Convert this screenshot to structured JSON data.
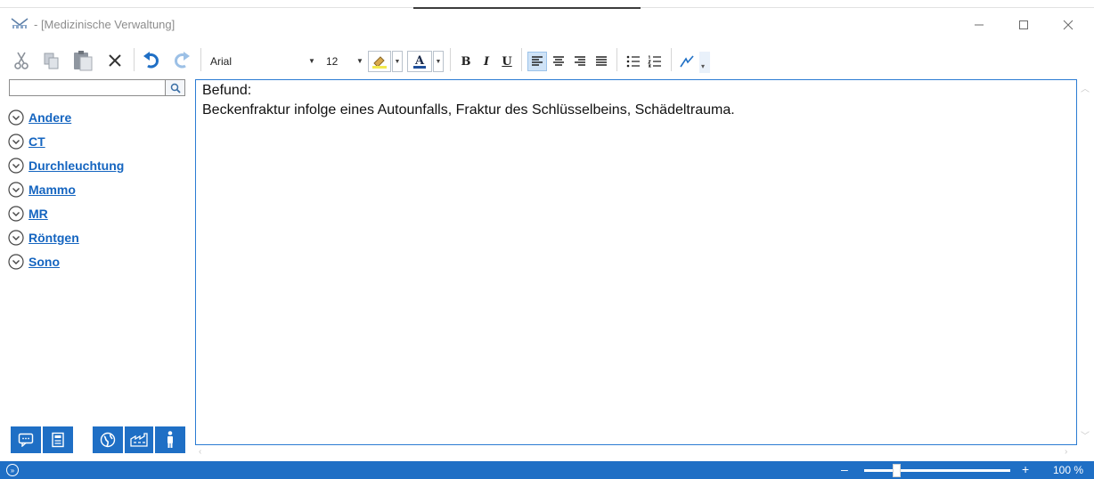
{
  "window": {
    "title": "- [Medizinische Verwaltung]",
    "app_icon": "app-logo-icon",
    "controls": [
      "minimize-icon",
      "maximize-icon",
      "close-icon"
    ]
  },
  "toolbar": {
    "buttons": [
      "cut-icon",
      "copy-icon",
      "paste-icon",
      "delete-icon",
      "undo-icon",
      "redo-icon"
    ],
    "font_name": "Arial",
    "font_size": "12",
    "format_buttons": {
      "highlight": "highlight-color-icon",
      "font_color": "font-color-icon",
      "bold": "B",
      "italic": "I",
      "underline": "U"
    },
    "alignment": [
      "align-left-icon",
      "align-center-icon",
      "align-right-icon",
      "justify-icon"
    ],
    "active_alignment": "align-left",
    "lists": [
      "bullet-list-icon",
      "numbered-list-icon"
    ],
    "extra": "signature-icon"
  },
  "left_panel": {
    "search": {
      "value": "",
      "placeholder": ""
    },
    "categories": [
      {
        "label": "Andere"
      },
      {
        "label": "CT"
      },
      {
        "label": "Durchleuchtung"
      },
      {
        "label": "Mammo"
      },
      {
        "label": "MR"
      },
      {
        "label": "Röntgen"
      },
      {
        "label": "Sono"
      }
    ],
    "bottom_buttons": [
      "chat-icon",
      "document-icon",
      "globe-icon",
      "factory-icon",
      "person-icon"
    ]
  },
  "editor": {
    "lines": [
      "Befund:",
      "Beckenfraktur infolge eines Autounfalls, Fraktur des Schlüsselbeins, Schädeltrauma."
    ]
  },
  "statusbar": {
    "zoom_minus": "–",
    "zoom_plus": "+",
    "zoom_label": "100 %",
    "zoom_value": 100
  },
  "colors": {
    "accent": "#1f6fc5",
    "link": "#1565c0",
    "editor_border": "#2b7cd3",
    "title_text": "#8c8c8c"
  }
}
